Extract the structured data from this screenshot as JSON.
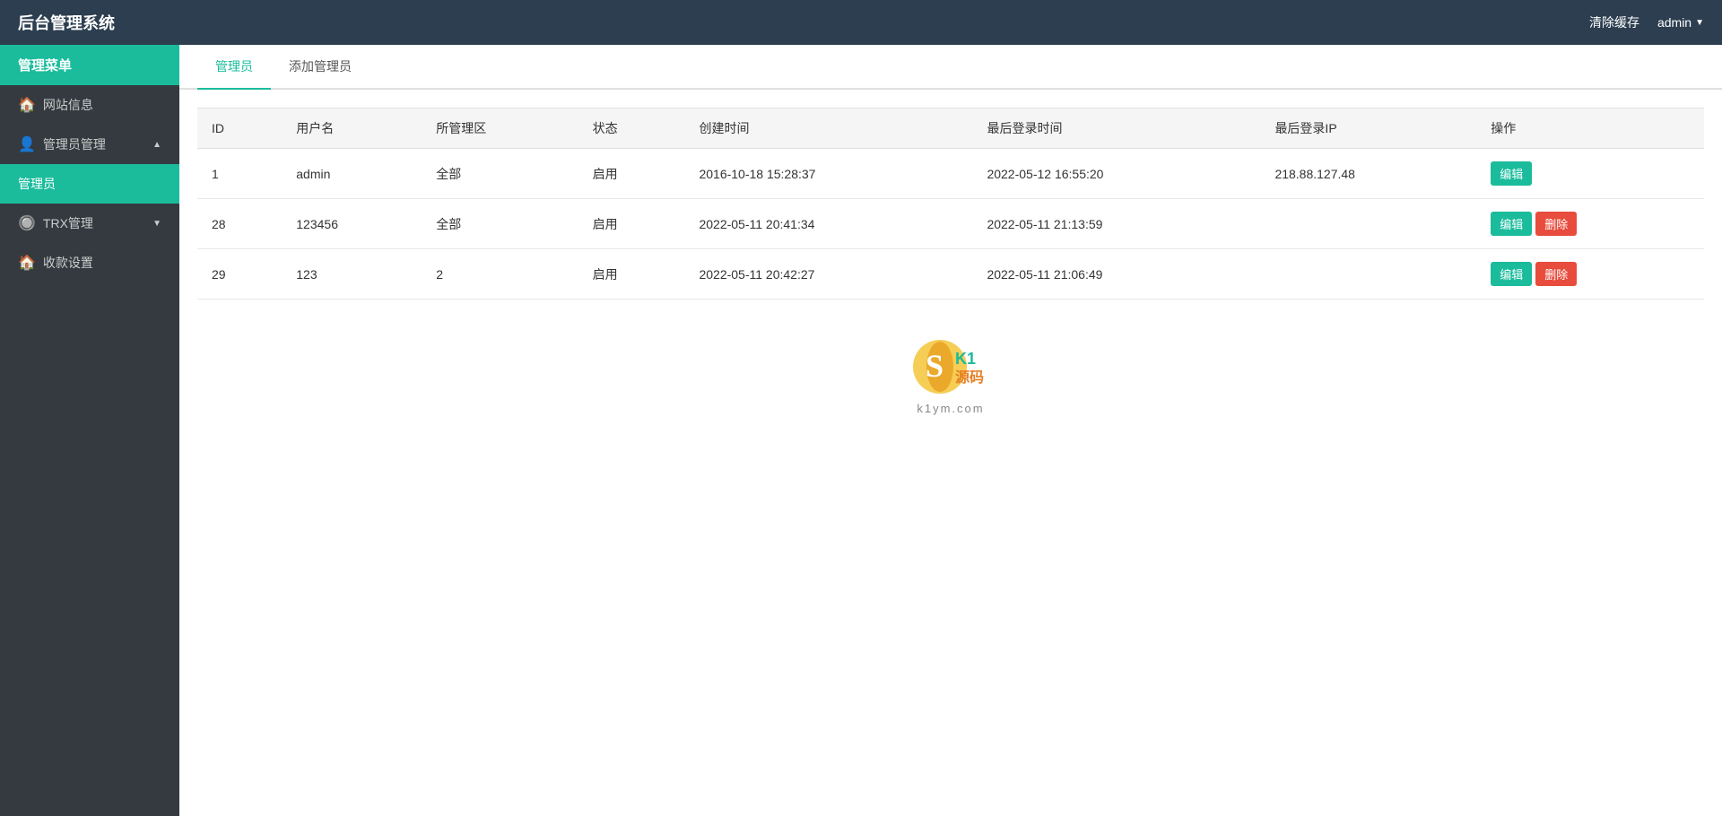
{
  "header": {
    "title": "后台管理系统",
    "clear_cache": "清除缓存",
    "admin": "admin"
  },
  "sidebar": {
    "menu_title": "管理菜单",
    "items": [
      {
        "id": "website-info",
        "label": "网站信息",
        "icon": "🏠",
        "active": false,
        "indent": false
      },
      {
        "id": "admin-manage",
        "label": "管理员管理",
        "icon": "👤",
        "active": false,
        "indent": false,
        "has_arrow": true,
        "arrow": "▲"
      },
      {
        "id": "admin",
        "label": "管理员",
        "active": true,
        "indent": true
      },
      {
        "id": "trx-manage",
        "label": "TRX管理",
        "icon": "🔘",
        "active": false,
        "indent": false,
        "has_arrow": true,
        "arrow": "▼"
      },
      {
        "id": "payment-settings",
        "label": "收款设置",
        "icon": "🏠",
        "active": false,
        "indent": false
      }
    ]
  },
  "tabs": [
    {
      "id": "admin-list",
      "label": "管理员",
      "active": true
    },
    {
      "id": "add-admin",
      "label": "添加管理员",
      "active": false
    }
  ],
  "table": {
    "columns": [
      "ID",
      "用户名",
      "所管理区",
      "状态",
      "创建时间",
      "最后登录时间",
      "最后登录IP",
      "操作"
    ],
    "rows": [
      {
        "id": "1",
        "username": "admin",
        "region": "全部",
        "status": "启用",
        "created_at": "2016-10-18 15:28:37",
        "last_login": "2022-05-12 16:55:20",
        "last_ip": "218.88.127.48",
        "can_delete": false
      },
      {
        "id": "28",
        "username": "123456",
        "region": "全部",
        "status": "启用",
        "created_at": "2022-05-11 20:41:34",
        "last_login": "2022-05-11 21:13:59",
        "last_ip": "",
        "can_delete": true
      },
      {
        "id": "29",
        "username": "123",
        "region": "2",
        "status": "启用",
        "created_at": "2022-05-11 20:42:27",
        "last_login": "2022-05-11 21:06:49",
        "last_ip": "",
        "can_delete": true
      }
    ],
    "btn_edit": "编辑",
    "btn_delete": "删除"
  },
  "watermark": {
    "text": "K1源码",
    "url": "k1ym.com"
  }
}
